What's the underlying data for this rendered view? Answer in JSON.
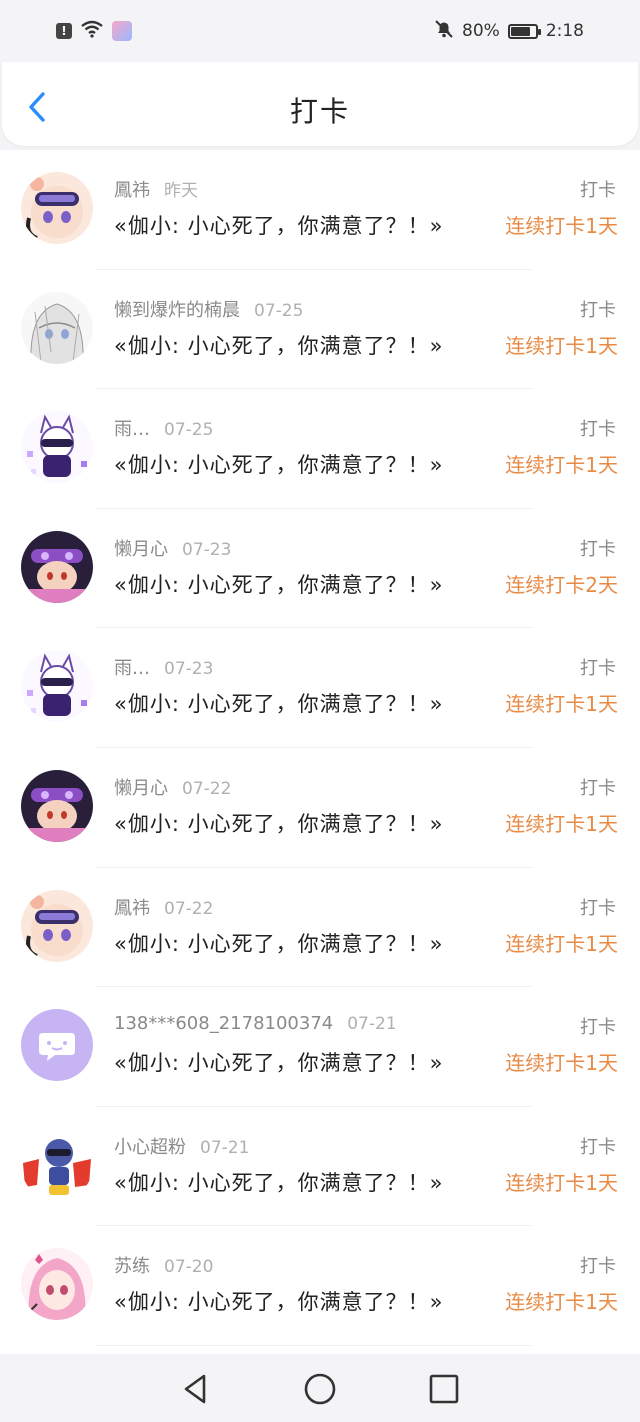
{
  "status_bar": {
    "battery_text": "80%",
    "battery_level": 0.8,
    "time": "2:18",
    "icons": [
      "alert-icon",
      "wifi-icon",
      "app-notification-icon",
      "bell-off-icon",
      "battery-icon"
    ]
  },
  "header": {
    "title": "打卡",
    "back_icon": "chevron-left-icon"
  },
  "colors": {
    "accent": "#2a8cff",
    "streak": "#e98a45",
    "avatar_purple": "#c7b4f3"
  },
  "items": [
    {
      "user": "鳳祎",
      "date": "昨天",
      "type": "打卡",
      "content": "«伽小: 小心死了，你满意了？！»",
      "streak": "连续打卡1天",
      "avatar": "avatar-1"
    },
    {
      "user": "懒到爆炸的楠晨",
      "date": "07-25",
      "type": "打卡",
      "content": "«伽小: 小心死了，你满意了？！»",
      "streak": "连续打卡1天",
      "avatar": "avatar-2"
    },
    {
      "user": "雨…",
      "date": "07-25",
      "type": "打卡",
      "content": "«伽小: 小心死了，你满意了？！»",
      "streak": "连续打卡1天",
      "avatar": "avatar-3"
    },
    {
      "user": "懒月心",
      "date": "07-23",
      "type": "打卡",
      "content": "«伽小: 小心死了，你满意了？！»",
      "streak": "连续打卡2天",
      "avatar": "avatar-4"
    },
    {
      "user": "雨…",
      "date": "07-23",
      "type": "打卡",
      "content": "«伽小: 小心死了，你满意了？！»",
      "streak": "连续打卡1天",
      "avatar": "avatar-3"
    },
    {
      "user": "懒月心",
      "date": "07-22",
      "type": "打卡",
      "content": "«伽小: 小心死了，你满意了？！»",
      "streak": "连续打卡1天",
      "avatar": "avatar-4"
    },
    {
      "user": "鳳祎",
      "date": "07-22",
      "type": "打卡",
      "content": "«伽小: 小心死了，你满意了？！»",
      "streak": "连续打卡1天",
      "avatar": "avatar-1"
    },
    {
      "user": "138***608_2178100374",
      "date": "07-21",
      "type": "打卡",
      "content": "«伽小: 小心死了，你满意了？！»",
      "streak": "连续打卡1天",
      "avatar": "avatar-default"
    },
    {
      "user": "小心超粉",
      "date": "07-21",
      "type": "打卡",
      "content": "«伽小: 小心死了，你满意了？！»",
      "streak": "连续打卡1天",
      "avatar": "avatar-5"
    },
    {
      "user": "苏练",
      "date": "07-20",
      "type": "打卡",
      "content": "«伽小: 小心死了，你满意了？！»",
      "streak": "连续打卡1天",
      "avatar": "avatar-6"
    }
  ],
  "nav": {
    "back": "triangle-back-icon",
    "home": "circle-home-icon",
    "recent": "square-recent-icon"
  }
}
